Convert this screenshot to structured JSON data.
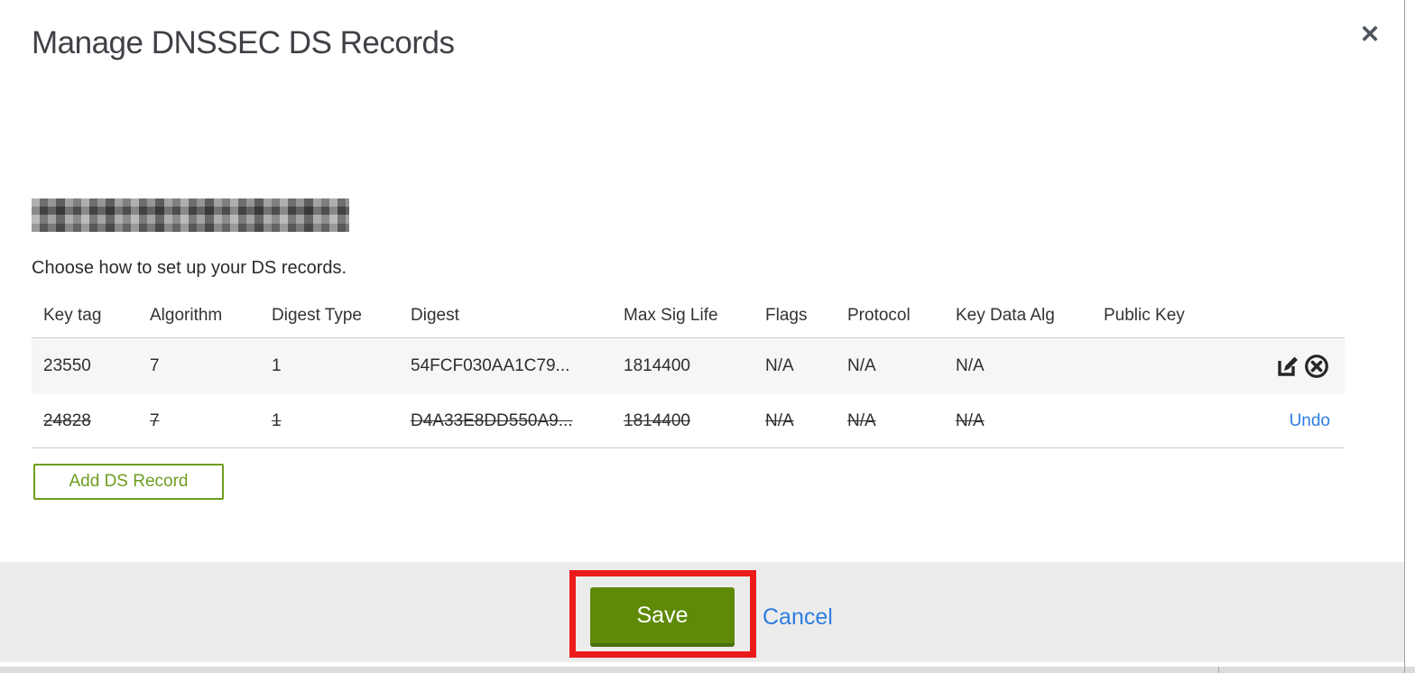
{
  "modal": {
    "title": "Manage DNSSEC DS Records",
    "close_icon": "✕",
    "instruction": "Choose how to set up your DS records.",
    "table": {
      "columns": [
        "Key tag",
        "Algorithm",
        "Digest Type",
        "Digest",
        "Max Sig Life",
        "Flags",
        "Protocol",
        "Key Data Alg",
        "Public Key"
      ],
      "rows": [
        {
          "key_tag": "23550",
          "algorithm": "7",
          "digest_type": "1",
          "digest": "54FCF030AA1C79...",
          "max_sig_life": "1814400",
          "flags": "N/A",
          "protocol": "N/A",
          "key_data_alg": "N/A",
          "public_key": "",
          "state": "active"
        },
        {
          "key_tag": "24828",
          "algorithm": "7",
          "digest_type": "1",
          "digest": "D4A33E8DD550A9...",
          "max_sig_life": "1814400",
          "flags": "N/A",
          "protocol": "N/A",
          "key_data_alg": "N/A",
          "public_key": "",
          "state": "deleted",
          "action_label": "Undo"
        }
      ]
    },
    "add_button_label": "Add DS Record",
    "footer": {
      "save_label": "Save",
      "cancel_label": "Cancel"
    }
  },
  "colors": {
    "primary_green": "#5e8a08",
    "outline_green": "#6e9d20",
    "link_blue": "#2e7de1",
    "annotation_red": "#ec1b1b",
    "footer_gray": "#ececec",
    "row_stripe": "#f6f6f6"
  }
}
